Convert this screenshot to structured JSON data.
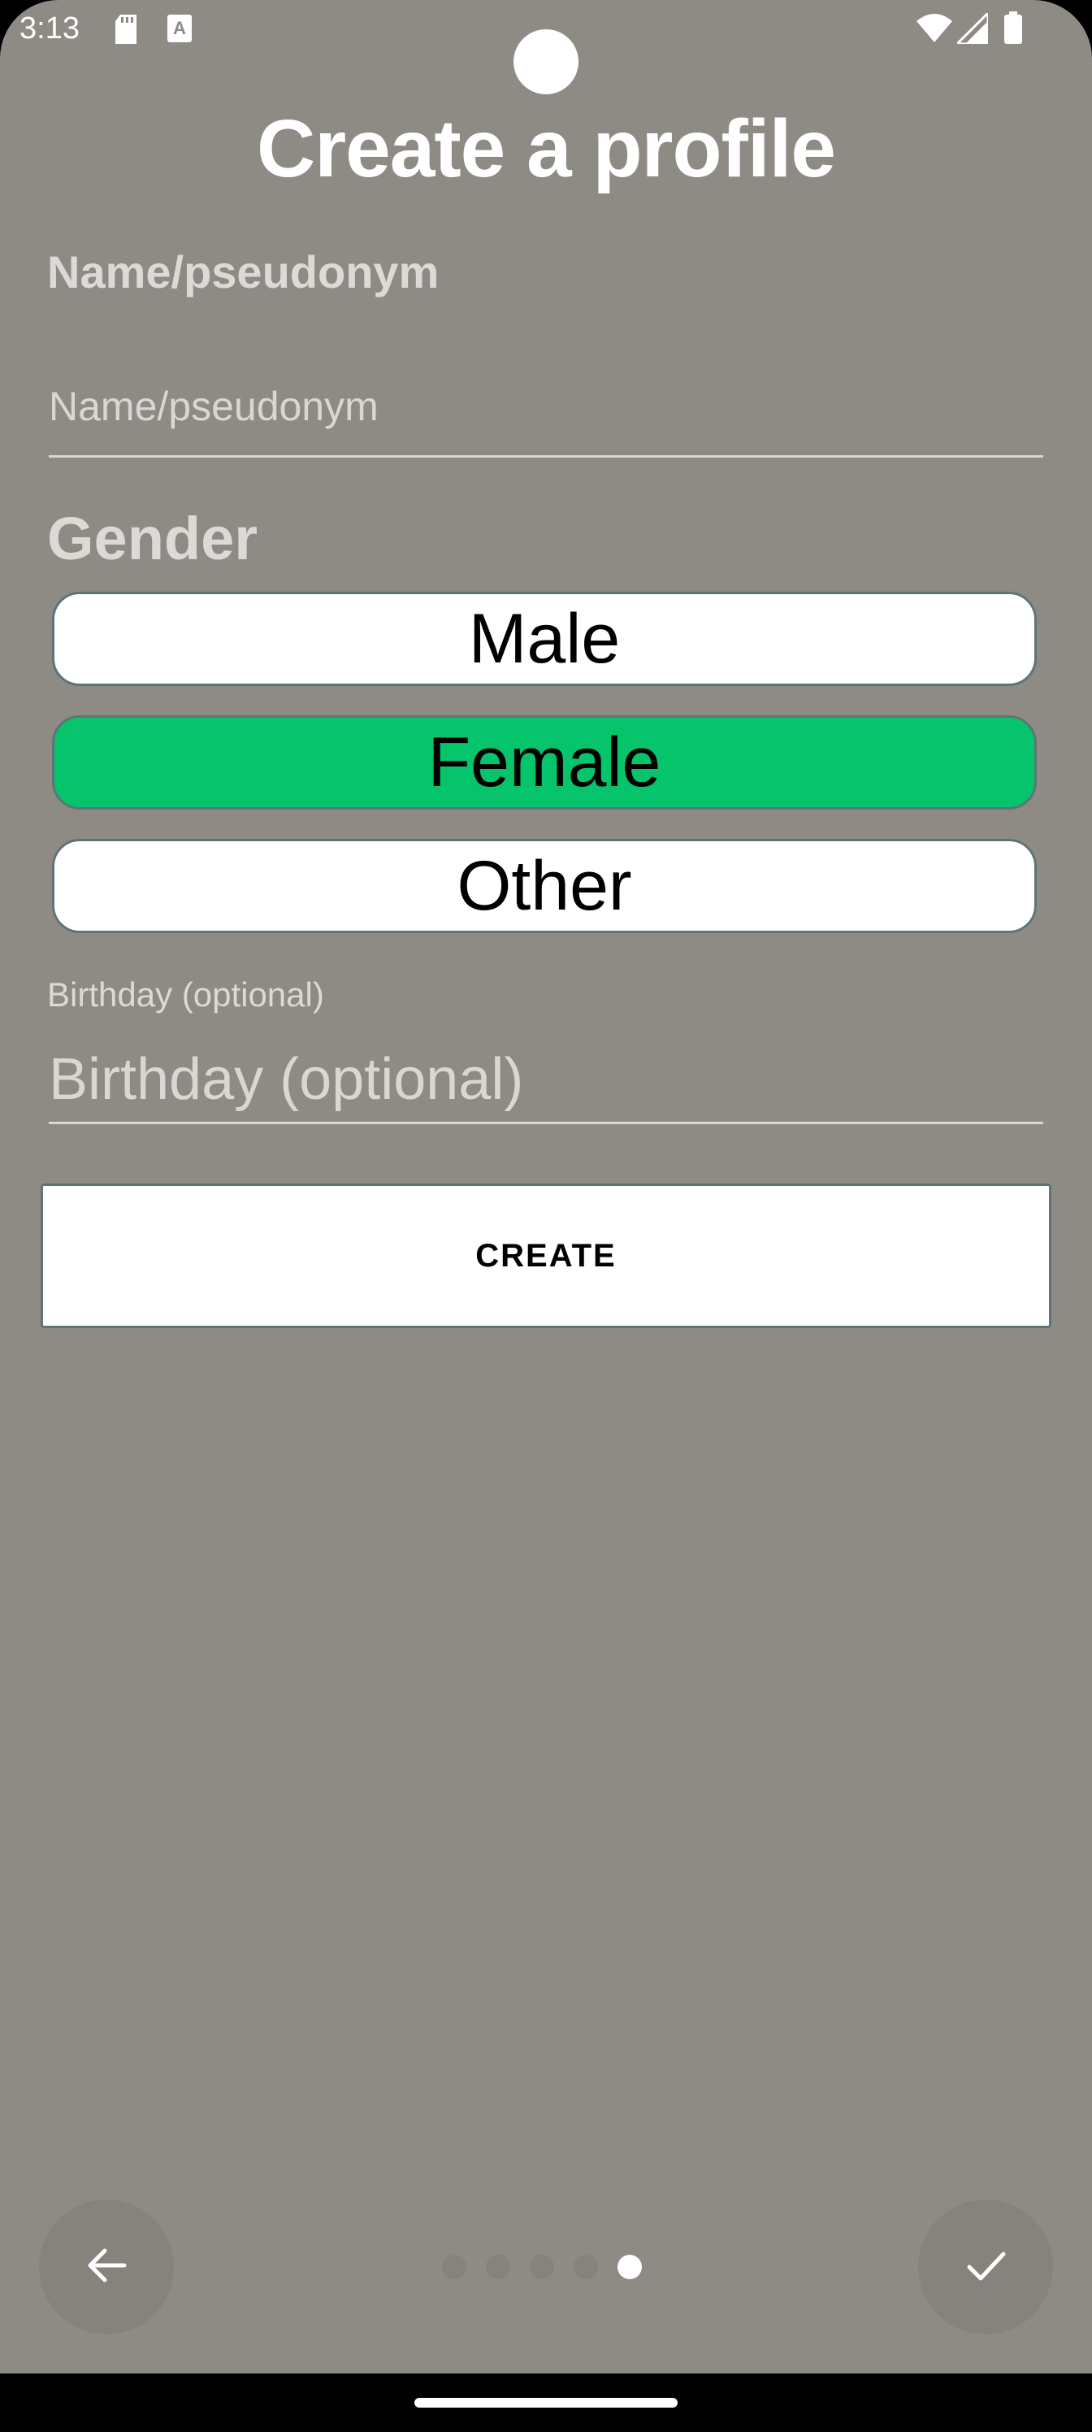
{
  "status_bar": {
    "time": "3:13",
    "icons": [
      "sd-card-icon",
      "text-a-icon",
      "wifi-icon",
      "signal-icon",
      "battery-icon"
    ]
  },
  "title": "Create a profile",
  "name_field": {
    "label": "Name/pseudonym",
    "placeholder": "Name/pseudonym",
    "value": ""
  },
  "gender": {
    "label": "Gender",
    "options": [
      {
        "label": "Male",
        "selected": false
      },
      {
        "label": "Female",
        "selected": true
      },
      {
        "label": "Other",
        "selected": false
      }
    ],
    "selected_color": "#05c46b"
  },
  "birthday_field": {
    "label": "Birthday (optional)",
    "placeholder": "Birthday (optional)",
    "value": ""
  },
  "create_button": {
    "label": "CREATE"
  },
  "navigation": {
    "back_icon": "arrow-left-icon",
    "done_icon": "check-icon",
    "page_count": 5,
    "current_page": 5
  },
  "colors": {
    "background": "#8e8b85",
    "accent_selected": "#05c46b"
  }
}
